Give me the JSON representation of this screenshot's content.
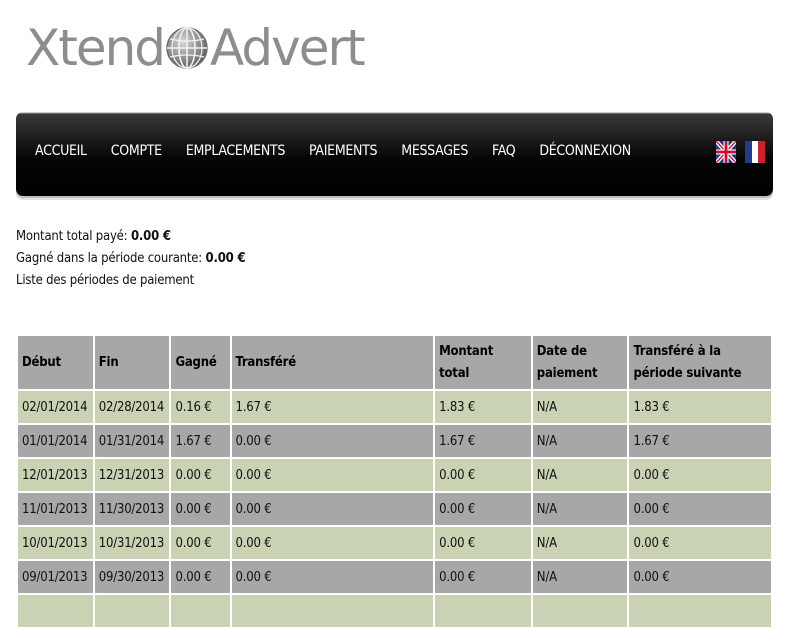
{
  "logo": {
    "text_left": "Xtend",
    "text_right": "Advert"
  },
  "nav": {
    "items": [
      "ACCUEIL",
      "COMPTE",
      "EMPLACEMENTS",
      "PAIEMENTS",
      "MESSAGES",
      "FAQ",
      "DÉCONNEXION"
    ],
    "flags": [
      "uk-flag-icon",
      "fr-flag-icon"
    ]
  },
  "summary": {
    "total_label": "Montant total payé:",
    "total_value": "0.00 €",
    "current_label": "Gagné dans la période courante:",
    "current_value": "0.00 €",
    "list_label": "Liste des périodes de paiement"
  },
  "table": {
    "headers": [
      "Début",
      "Fin",
      "Gagné",
      "Transféré",
      "Montant total",
      "Date de paiement",
      "Transféré à la période suivante"
    ],
    "rows": [
      [
        "02/01/2014",
        "02/28/2014",
        "0.16 €",
        "1.67 €",
        "1.83 €",
        "N/A",
        "1.83 €"
      ],
      [
        "01/01/2014",
        "01/31/2014",
        "1.67 €",
        "0.00 €",
        "1.67 €",
        "N/A",
        "1.67 €"
      ],
      [
        "12/01/2013",
        "12/31/2013",
        "0.00 €",
        "0.00 €",
        "0.00 €",
        "N/A",
        "0.00 €"
      ],
      [
        "11/01/2013",
        "11/30/2013",
        "0.00 €",
        "0.00 €",
        "0.00 €",
        "N/A",
        "0.00 €"
      ],
      [
        "10/01/2013",
        "10/31/2013",
        "0.00 €",
        "0.00 €",
        "0.00 €",
        "N/A",
        "0.00 €"
      ],
      [
        "09/01/2013",
        "09/30/2013",
        "0.00 €",
        "0.00 €",
        "0.00 €",
        "N/A",
        "0.00 €"
      ]
    ]
  },
  "colors": {
    "row_green": "#c9d3b4",
    "row_grey": "#a7a7a7",
    "header": "#a7a7a7",
    "nav_bg": "#000000"
  }
}
